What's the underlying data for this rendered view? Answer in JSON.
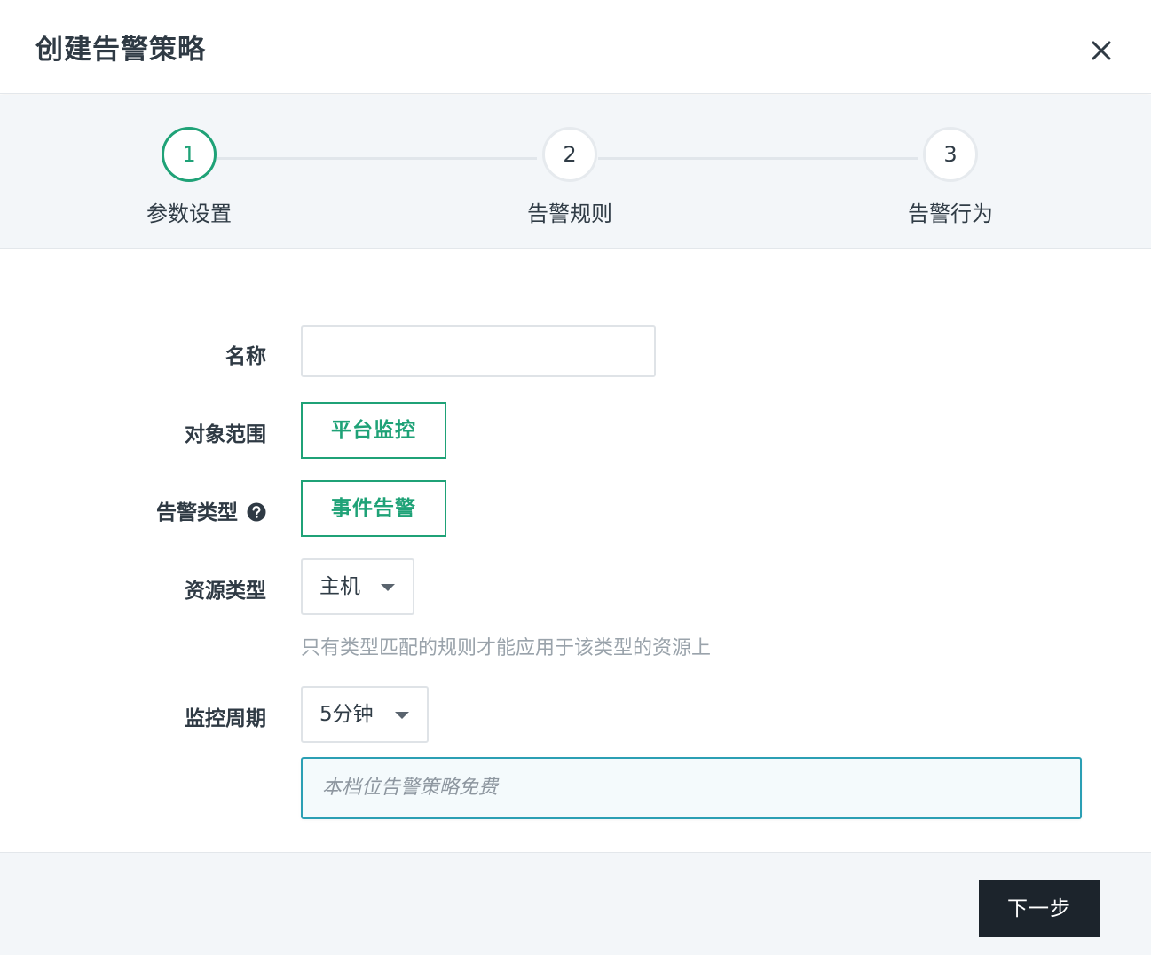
{
  "dialog": {
    "title": "创建告警策略"
  },
  "steps": [
    {
      "number": "1",
      "label": "参数设置",
      "active": true
    },
    {
      "number": "2",
      "label": "告警规则",
      "active": false
    },
    {
      "number": "3",
      "label": "告警行为",
      "active": false
    }
  ],
  "form": {
    "name": {
      "label": "名称",
      "value": ""
    },
    "scope": {
      "label": "对象范围",
      "option": "平台监控"
    },
    "alert_type": {
      "label": "告警类型",
      "option": "事件告警"
    },
    "resource_type": {
      "label": "资源类型",
      "selected": "主机",
      "hint": "只有类型匹配的规则才能应用于该类型的资源上"
    },
    "monitor_period": {
      "label": "监控周期",
      "selected": "5分钟",
      "notice": "本档位告警策略免费"
    }
  },
  "footer": {
    "next_label": "下一步"
  },
  "colors": {
    "accent": "#1fa277",
    "notice_border": "#2b9fb4",
    "primary_button": "#1c242c"
  }
}
